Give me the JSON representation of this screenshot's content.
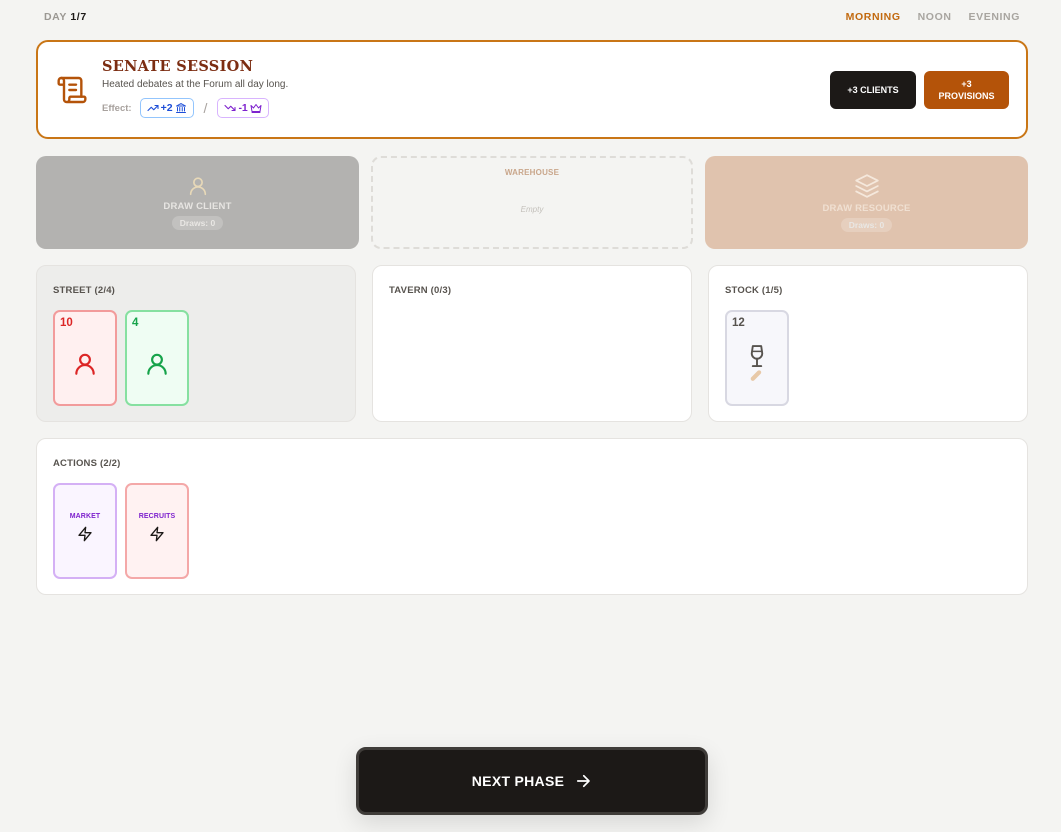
{
  "header": {
    "day_label": "DAY",
    "day_value": "1/7",
    "phases": [
      {
        "label": "MORNING",
        "active": true
      },
      {
        "label": "NOON",
        "active": false
      },
      {
        "label": "EVENING",
        "active": false
      }
    ]
  },
  "event": {
    "icon": "scroll-icon",
    "title": "SENATE SESSION",
    "description": "Heated debates at the Forum all day long.",
    "effect_label": "Effect:",
    "effects": [
      {
        "text": "+2",
        "trend_icon": "trend-up-icon",
        "stat_icon": "temple-icon",
        "color": "#1d4ed8"
      },
      {
        "text": "-1",
        "trend_icon": "trend-down-icon",
        "stat_icon": "crown-icon",
        "color": "#7e22ce"
      }
    ],
    "separator": "/",
    "choices": [
      {
        "label": "+3 CLIENTS",
        "color": "#1c1917"
      },
      {
        "label_line1": "+3",
        "label_line2": "PROVISIONS",
        "color": "#b45309"
      }
    ]
  },
  "draw": {
    "client": {
      "title": "DRAW CLIENT",
      "draws": "Draws: 0",
      "icon": "user-icon"
    },
    "warehouse": {
      "title": "WAREHOUSE",
      "empty_text": "Empty"
    },
    "resource": {
      "title": "DRAW RESOURCE",
      "draws": "Draws: 0",
      "icon": "layers-icon"
    }
  },
  "zones": {
    "street": {
      "title": "STREET (2/4)",
      "cards": [
        {
          "value": "10",
          "color": "red",
          "icon": "user-icon"
        },
        {
          "value": "4",
          "color": "green",
          "icon": "user-icon"
        }
      ]
    },
    "tavern": {
      "title": "TAVERN (0/3)"
    },
    "stock": {
      "title": "STOCK (1/5)",
      "cards": [
        {
          "value": "12",
          "icon": "wine-glass-icon"
        }
      ]
    },
    "actions": {
      "title": "ACTIONS (2/2)",
      "cards": [
        {
          "label": "MARKET",
          "icon": "lightning-icon"
        },
        {
          "label": "RECRUITS",
          "icon": "lightning-icon"
        }
      ]
    }
  },
  "next_phase": {
    "label": "NEXT PHASE",
    "icon": "arrow-right-icon"
  }
}
